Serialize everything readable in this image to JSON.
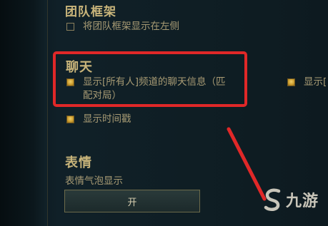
{
  "sections": {
    "team_frames": {
      "title": "团队框架",
      "option_label": "将团队框架显示在左侧",
      "option_checked": false
    },
    "chat": {
      "title": "聊天",
      "show_all_label_line1": "显示[所有人]频道的聊天信息（匹",
      "show_all_label_line2": "配对局）",
      "show_all_checked": true,
      "right_partial_label": "显示[",
      "right_partial_checked": true,
      "timestamp_label": "显示时间戳",
      "timestamp_checked": true
    },
    "emotes": {
      "title": "表情",
      "bubble_label": "表情气泡显示",
      "toggle_value": "开"
    }
  },
  "watermark": {
    "text": "九游"
  },
  "colors": {
    "background": "#0f1e24",
    "gold_text": "#c8b47a",
    "option_text": "#a89b74",
    "highlight": "#e02828"
  }
}
